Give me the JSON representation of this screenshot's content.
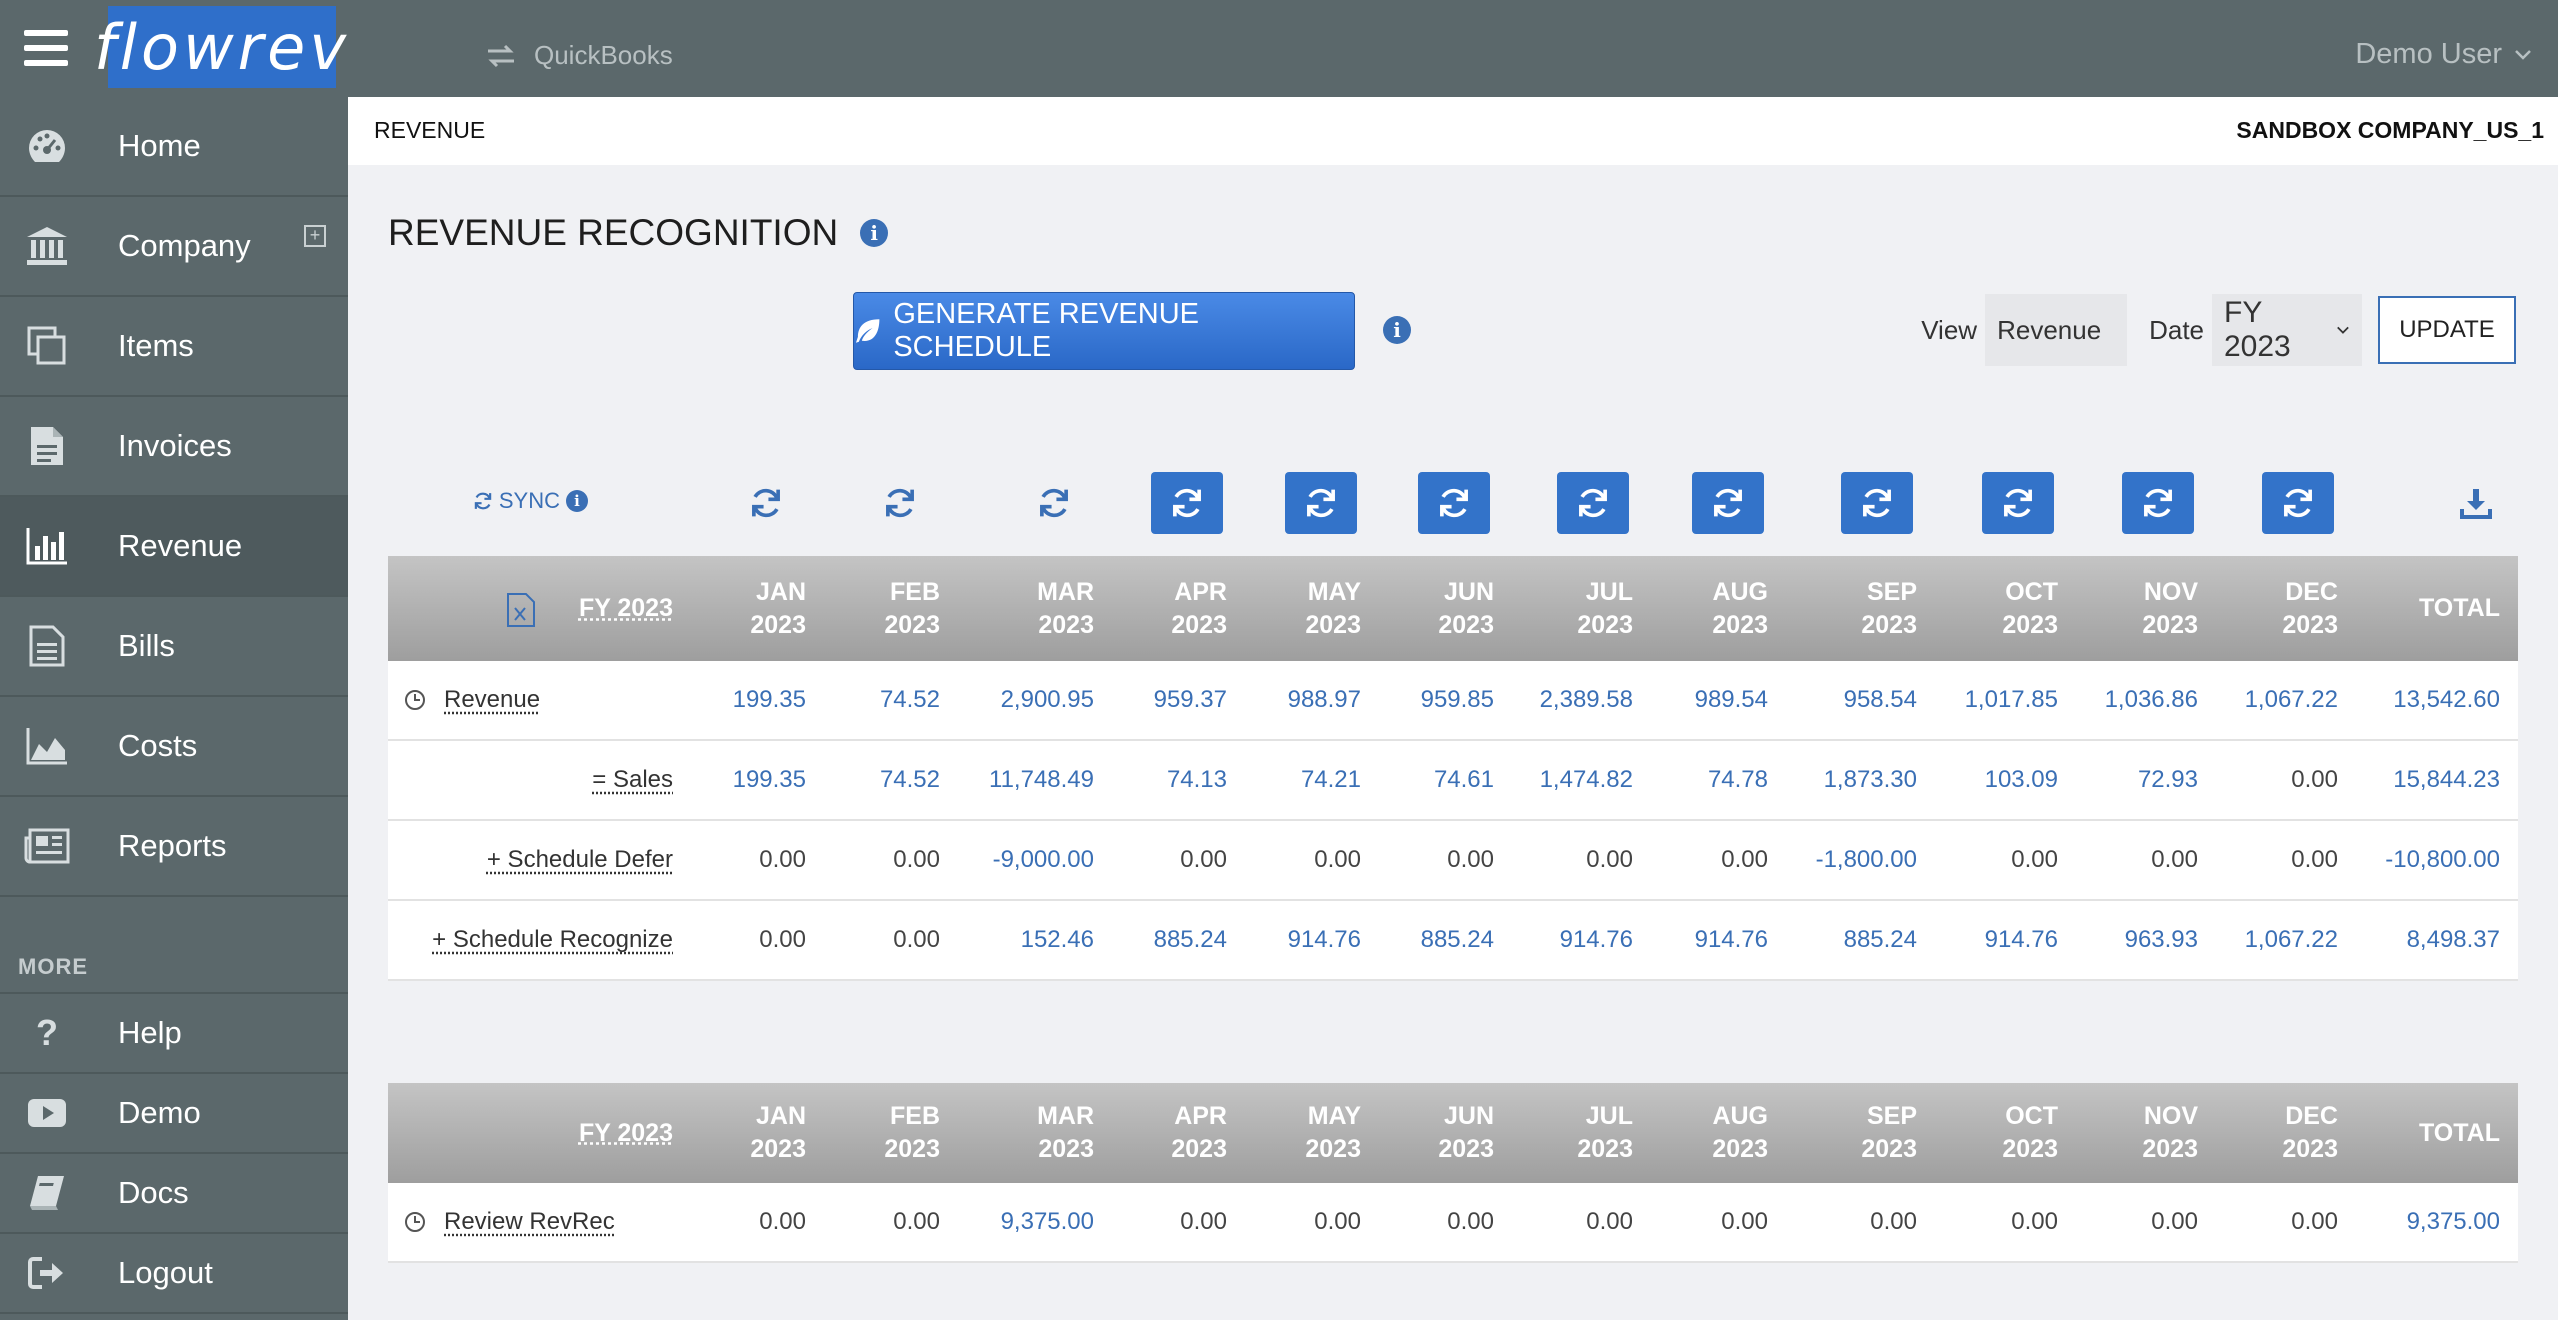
{
  "app": {
    "logo": "flowrev",
    "integration": "QuickBooks",
    "user": "Demo User"
  },
  "sidebar": {
    "items": [
      {
        "label": "Home",
        "icon": "dashboard-icon"
      },
      {
        "label": "Company",
        "icon": "bank-icon",
        "has_add": true
      },
      {
        "label": "Items",
        "icon": "copy-icon"
      },
      {
        "label": "Invoices",
        "icon": "document-icon"
      },
      {
        "label": "Revenue",
        "icon": "bar-chart-icon",
        "active": true
      },
      {
        "label": "Bills",
        "icon": "file-icon"
      },
      {
        "label": "Costs",
        "icon": "area-chart-icon"
      },
      {
        "label": "Reports",
        "icon": "newspaper-icon"
      }
    ],
    "more_label": "MORE",
    "more_items": [
      {
        "label": "Help",
        "icon": "question-icon"
      },
      {
        "label": "Demo",
        "icon": "youtube-icon"
      },
      {
        "label": "Docs",
        "icon": "book-icon"
      },
      {
        "label": "Logout",
        "icon": "logout-icon"
      }
    ]
  },
  "header": {
    "breadcrumb": "REVENUE",
    "company": "SANDBOX COMPANY_US_1"
  },
  "page": {
    "title": "REVENUE RECOGNITION",
    "generate_label": "GENERATE REVENUE SCHEDULE",
    "view_label": "View",
    "view_value": "Revenue",
    "date_label": "Date",
    "date_value": "FY 2023",
    "update_label": "UPDATE",
    "sync_label": "SYNC"
  },
  "table1": {
    "columns": [
      {
        "fy": "FY 2023"
      },
      {
        "m": "JAN",
        "y": "2023"
      },
      {
        "m": "FEB",
        "y": "2023"
      },
      {
        "m": "MAR",
        "y": "2023"
      },
      {
        "m": "APR",
        "y": "2023"
      },
      {
        "m": "MAY",
        "y": "2023"
      },
      {
        "m": "JUN",
        "y": "2023"
      },
      {
        "m": "JUL",
        "y": "2023"
      },
      {
        "m": "AUG",
        "y": "2023"
      },
      {
        "m": "SEP",
        "y": "2023"
      },
      {
        "m": "OCT",
        "y": "2023"
      },
      {
        "m": "NOV",
        "y": "2023"
      },
      {
        "m": "DEC",
        "y": "2023"
      },
      {
        "m": "TOTAL",
        "y": ""
      }
    ],
    "rows": [
      {
        "label": "Revenue",
        "clock": true,
        "values": [
          "199.35",
          "74.52",
          "2,900.95",
          "959.37",
          "988.97",
          "959.85",
          "2,389.58",
          "989.54",
          "958.54",
          "1,017.85",
          "1,036.86",
          "1,067.22",
          "13,542.60"
        ]
      },
      {
        "label": "= Sales",
        "values": [
          "199.35",
          "74.52",
          "11,748.49",
          "74.13",
          "74.21",
          "74.61",
          "1,474.82",
          "74.78",
          "1,873.30",
          "103.09",
          "72.93",
          "0.00",
          "15,844.23"
        ]
      },
      {
        "label": "+ Schedule Defer",
        "values": [
          "0.00",
          "0.00",
          "-9,000.00",
          "0.00",
          "0.00",
          "0.00",
          "0.00",
          "0.00",
          "-1,800.00",
          "0.00",
          "0.00",
          "0.00",
          "-10,800.00"
        ]
      },
      {
        "label": "+ Schedule Recognize",
        "values": [
          "0.00",
          "0.00",
          "152.46",
          "885.24",
          "914.76",
          "885.24",
          "914.76",
          "914.76",
          "885.24",
          "914.76",
          "963.93",
          "1,067.22",
          "8,498.37"
        ]
      }
    ]
  },
  "table2": {
    "fy": "FY 2023",
    "rows": [
      {
        "label": "Review RevRec",
        "clock": true,
        "values": [
          "0.00",
          "0.00",
          "9,375.00",
          "0.00",
          "0.00",
          "0.00",
          "0.00",
          "0.00",
          "0.00",
          "0.00",
          "0.00",
          "0.00",
          "9,375.00"
        ]
      }
    ]
  },
  "colors": {
    "accent": "#3a6fb5",
    "sidebar": "#5b686b",
    "button": "#3373c9"
  }
}
